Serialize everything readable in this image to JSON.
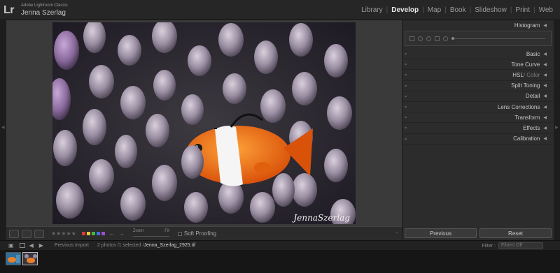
{
  "app": {
    "logo": "Lr",
    "product_name": "Adobe Lightroom Classic",
    "user_name": "Jenna Szerlag"
  },
  "modules": [
    "Library",
    "Develop",
    "Map",
    "Book",
    "Slideshow",
    "Print",
    "Web"
  ],
  "active_module": "Develop",
  "photo": {
    "signature": "JennaSzerlag"
  },
  "toolbar": {
    "stars": "★★★★★",
    "color_labels": [
      "#d93a3a",
      "#e3c934",
      "#47b34a",
      "#3f6fd8",
      "#9d4ed1"
    ],
    "zoom_label": "Zoom",
    "zoom_fit": "Fit",
    "soft_proofing": "Soft Proofing"
  },
  "panel": {
    "histogram": "Histogram",
    "sections": [
      "Basic",
      "Tone Curve",
      "HSL",
      "Split Toning",
      "Detail",
      "Lens Corrections",
      "Transform",
      "Effects",
      "Calibration"
    ],
    "hsl_extra": " / Color",
    "previous": "Previous",
    "reset": "Reset"
  },
  "filmstrip": {
    "source": "Previous Import",
    "count": "2 photos /1 selected /",
    "filename": "Jenna_Szerlag_2925.tif",
    "filter_label": "Filter :",
    "filter_value": "Filters Off"
  }
}
